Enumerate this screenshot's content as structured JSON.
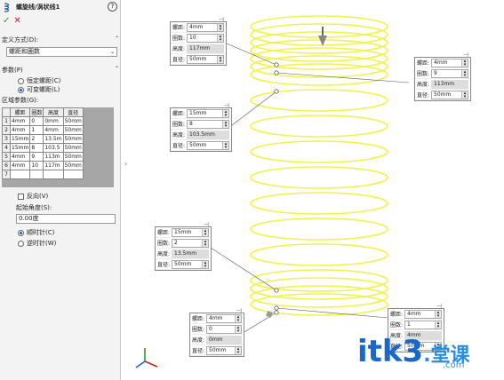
{
  "panel": {
    "title": "螺旋线/涡状线1",
    "help_glyph": "?",
    "ok_glyph": "✓",
    "cancel_glyph": "✕",
    "definition_label": "定义方式(D):",
    "definition_value": "螺距和圈数",
    "params_label": "参数(P)",
    "radio_constant": "恒定螺距(C)",
    "radio_variable": "可变螺距(L)",
    "region_label": "区域参数(G):",
    "table_headers": [
      "",
      "螺距",
      "圈数",
      "高度",
      "直径"
    ],
    "table_rows": [
      [
        "1",
        "4mm",
        "0",
        "0mm",
        "50mm"
      ],
      [
        "2",
        "4mm",
        "1",
        "4mm",
        "50mm"
      ],
      [
        "3",
        "15mm",
        "2",
        "13.5m",
        "50mm"
      ],
      [
        "4",
        "15mm",
        "8",
        "103.5",
        "50mm"
      ],
      [
        "5",
        "4mm",
        "9",
        "113m",
        "50mm"
      ],
      [
        "6",
        "4mm",
        "10",
        "117m",
        "50mm"
      ],
      [
        "7",
        "",
        "",
        "",
        ""
      ]
    ],
    "reverse_label": "反向(V)",
    "start_angle_label": "起始角度(S):",
    "start_angle_value": "0.00度",
    "clockwise_label": "顺时针(C)",
    "counterclockwise_label": "逆时针(W)"
  },
  "callouts": [
    {
      "pitch": "4mm",
      "turns": "10",
      "height": "117mm",
      "diameter": "50mm"
    },
    {
      "pitch": "4mm",
      "turns": "9",
      "height": "113mm",
      "diameter": "50mm"
    },
    {
      "pitch": "15mm",
      "turns": "8",
      "height": "103.5mm",
      "diameter": "50mm"
    },
    {
      "pitch": "15mm",
      "turns": "2",
      "height": "13.5mm",
      "diameter": "50mm"
    },
    {
      "pitch": "4mm",
      "turns": "0",
      "height": "0mm",
      "diameter": "50mm"
    },
    {
      "pitch": "4mm",
      "turns": "1",
      "height": "4mm",
      "diameter": "50mm"
    }
  ],
  "callout_labels": {
    "pitch": "螺距:",
    "turns": "圈数:",
    "height": "高度:",
    "diameter": "直径:"
  },
  "watermark": {
    "main": "itk3",
    "cn": ".堂课",
    "sub": ".com"
  },
  "colors": {
    "helix": "#f2f24a",
    "accent": "#1b66c9"
  }
}
